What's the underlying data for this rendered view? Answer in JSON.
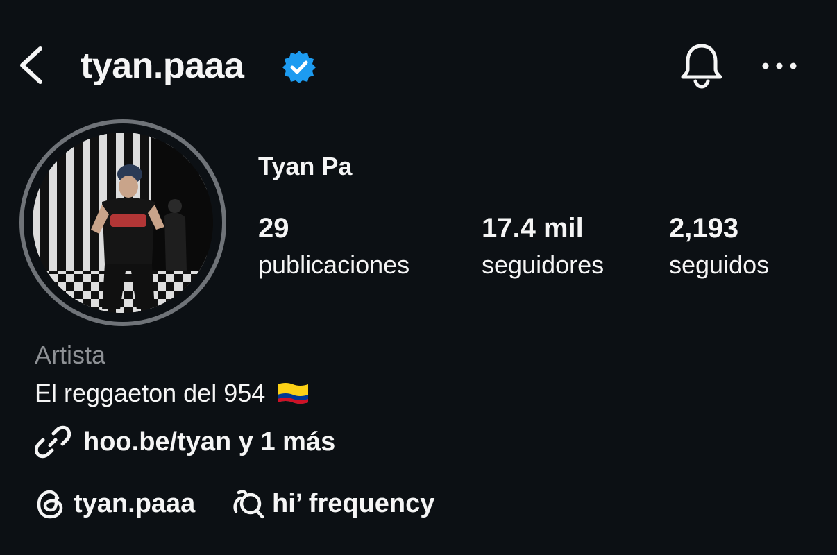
{
  "header": {
    "username": "tyan.paaa",
    "verified_color": "#1d9bf0",
    "icons": [
      "back-arrow-icon",
      "verified-badge-icon",
      "notification-bell-icon",
      "more-options-icon"
    ]
  },
  "profile": {
    "display_name": "Tyan Pa",
    "stats": [
      {
        "value": "29",
        "label": "publicaciones"
      },
      {
        "value": "17.4 mil",
        "label": "seguidores"
      },
      {
        "value": "2,193",
        "label": "seguidos"
      }
    ],
    "category": "Artista",
    "bio": "El reggaeton del 954",
    "bio_flag": "colombia-flag-icon",
    "link": "hoo.be/tyan y 1 más",
    "threads_handle": "tyan.paaa",
    "music": "hi’ frequency"
  },
  "colors": {
    "background": "#0c1014",
    "text": "#f5f5f5",
    "muted": "#8e9195",
    "avatar_ring": "#6f7378"
  }
}
